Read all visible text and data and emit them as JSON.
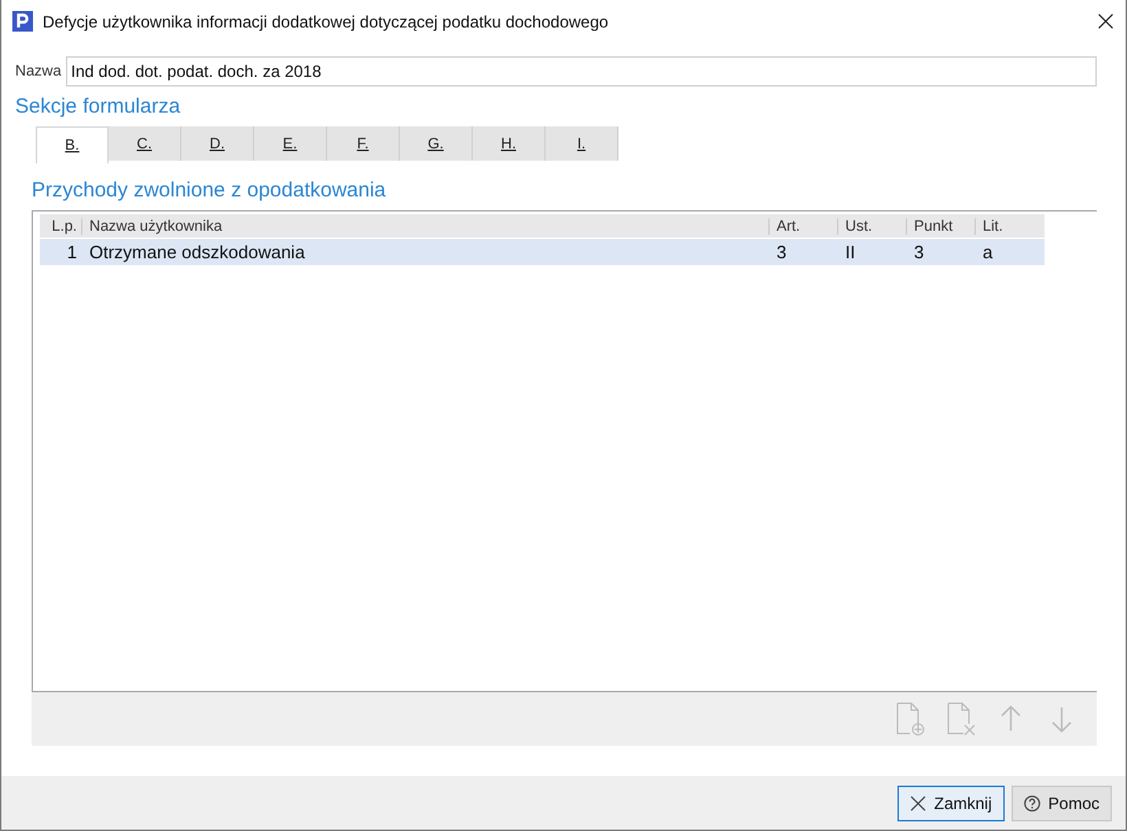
{
  "window": {
    "title": "Defycje użytkownika informacji dodatkowej dotyczącej podatku dochodowego"
  },
  "name_field": {
    "label": "Nazwa",
    "value": "Ind dod. dot. podat. doch. za 2018"
  },
  "sections_title": "Sekcje formularza",
  "tabs": [
    {
      "label": "B.",
      "selected": true
    },
    {
      "label": "C.",
      "selected": false
    },
    {
      "label": "D.",
      "selected": false
    },
    {
      "label": "E.",
      "selected": false
    },
    {
      "label": "F.",
      "selected": false
    },
    {
      "label": "G.",
      "selected": false
    },
    {
      "label": "H.",
      "selected": false
    },
    {
      "label": "I.",
      "selected": false
    }
  ],
  "panel_title": "Przychody zwolnione z opodatkowania",
  "table": {
    "columns": [
      "L.p.",
      "Nazwa użytkownika",
      "Art.",
      "Ust.",
      "Punkt",
      "Lit."
    ],
    "rows": [
      {
        "cells": [
          "1",
          "Otrzymane odszkodowania",
          "3",
          "II",
          "3",
          "a"
        ],
        "selected": true
      }
    ]
  },
  "buttons": [
    {
      "label": "Zamknij",
      "kind": "close",
      "focused": true
    },
    {
      "label": "Pomoc",
      "kind": "help",
      "focused": false
    }
  ]
}
